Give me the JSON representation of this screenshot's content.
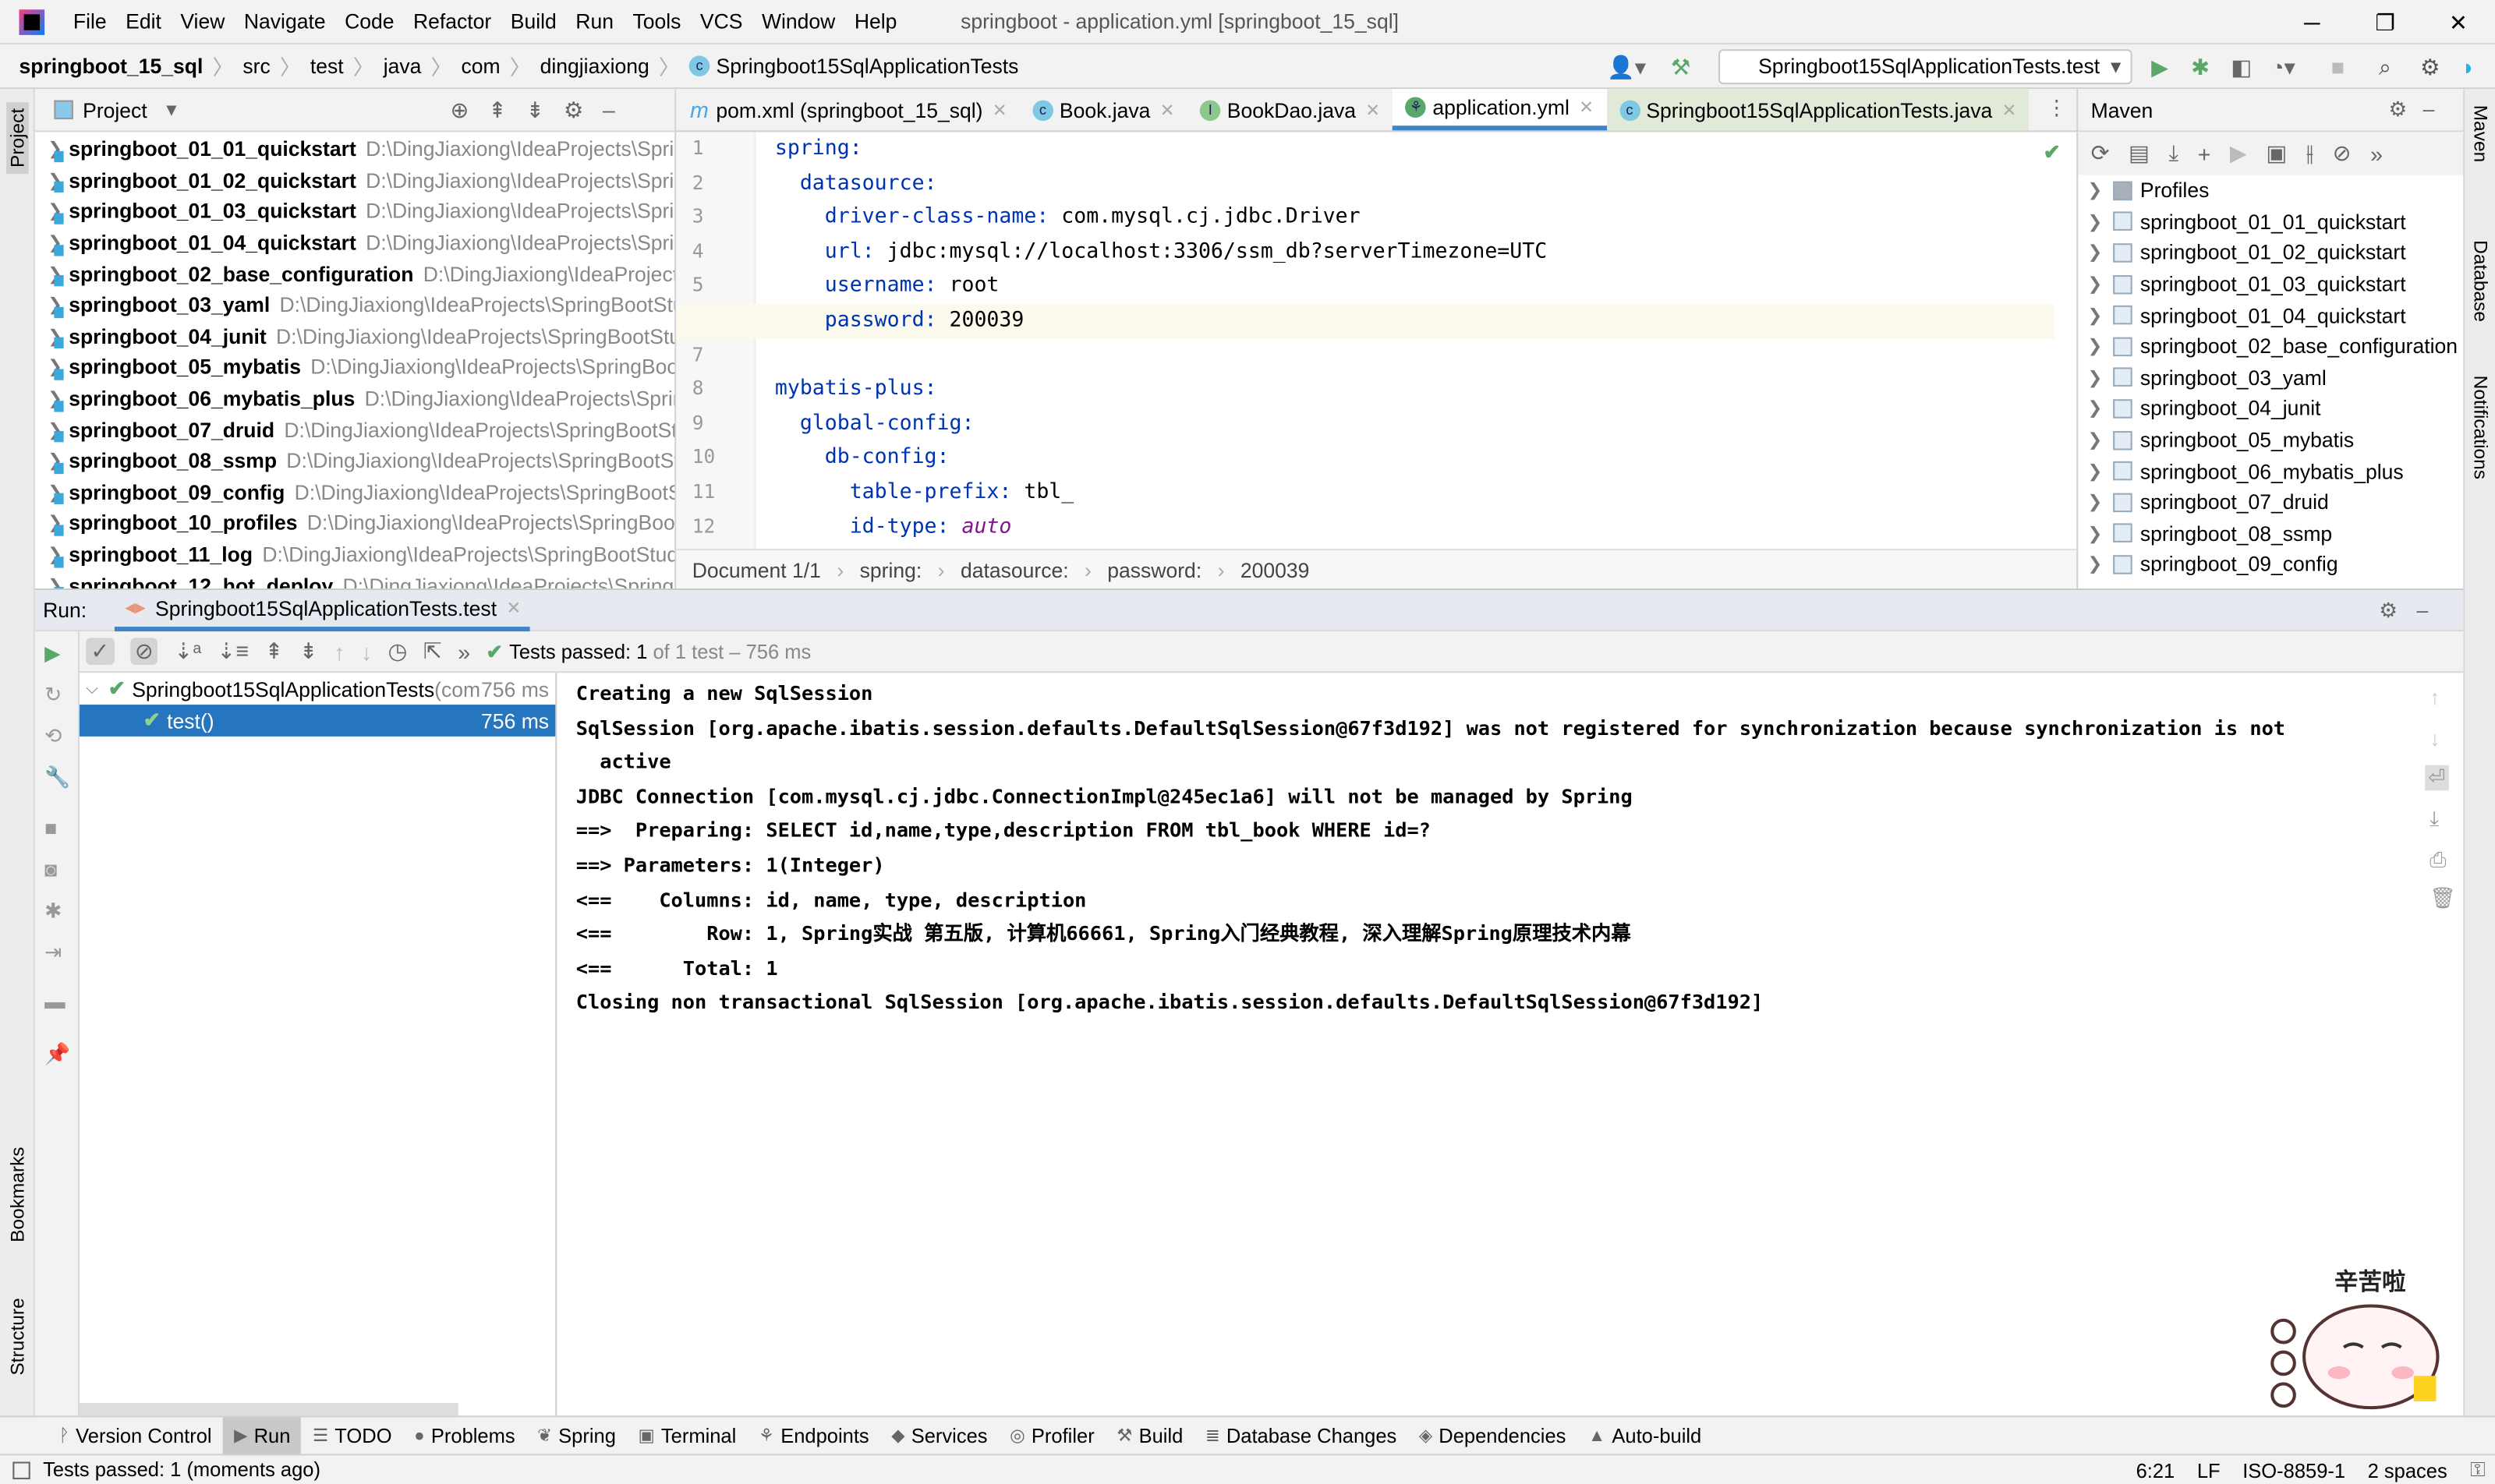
{
  "menu": {
    "items": [
      "File",
      "Edit",
      "View",
      "Navigate",
      "Code",
      "Refactor",
      "Build",
      "Run",
      "Tools",
      "VCS",
      "Window",
      "Help"
    ],
    "window_title": "springboot - application.yml [springboot_15_sql]"
  },
  "navbar": {
    "crumbs": [
      "springboot_15_sql",
      "src",
      "test",
      "java",
      "com",
      "dingjiaxiong",
      "Springboot15SqlApplicationTests"
    ],
    "run_config": "Springboot15SqlApplicationTests.test"
  },
  "left_stripe": {
    "project": "Project",
    "bookmarks": "Bookmarks",
    "structure": "Structure"
  },
  "project": {
    "title": "Project",
    "items": [
      {
        "name": "springboot_01_01_quickstart",
        "path": "D:\\DingJiaxiong\\IdeaProjects\\SpringBootStudy"
      },
      {
        "name": "springboot_01_02_quickstart",
        "path": "D:\\DingJiaxiong\\IdeaProjects\\SpringBootStudy"
      },
      {
        "name": "springboot_01_03_quickstart",
        "path": "D:\\DingJiaxiong\\IdeaProjects\\SpringBootStudy"
      },
      {
        "name": "springboot_01_04_quickstart",
        "path": "D:\\DingJiaxiong\\IdeaProjects\\SpringBootStudy"
      },
      {
        "name": "springboot_02_base_configuration",
        "path": "D:\\DingJiaxiong\\IdeaProjects\\SpringBootStudy"
      },
      {
        "name": "springboot_03_yaml",
        "path": "D:\\DingJiaxiong\\IdeaProjects\\SpringBootStudy"
      },
      {
        "name": "springboot_04_junit",
        "path": "D:\\DingJiaxiong\\IdeaProjects\\SpringBootStudy"
      },
      {
        "name": "springboot_05_mybatis",
        "path": "D:\\DingJiaxiong\\IdeaProjects\\SpringBootStudy"
      },
      {
        "name": "springboot_06_mybatis_plus",
        "path": "D:\\DingJiaxiong\\IdeaProjects\\SpringBootStudy"
      },
      {
        "name": "springboot_07_druid",
        "path": "D:\\DingJiaxiong\\IdeaProjects\\SpringBootStudy"
      },
      {
        "name": "springboot_08_ssmp",
        "path": "D:\\DingJiaxiong\\IdeaProjects\\SpringBootStudy"
      },
      {
        "name": "springboot_09_config",
        "path": "D:\\DingJiaxiong\\IdeaProjects\\SpringBootStudy"
      },
      {
        "name": "springboot_10_profiles",
        "path": "D:\\DingJiaxiong\\IdeaProjects\\SpringBootStudy"
      },
      {
        "name": "springboot_11_log",
        "path": "D:\\DingJiaxiong\\IdeaProjects\\SpringBootStudy"
      },
      {
        "name": "springboot_12_hot_deploy",
        "path": "D:\\DingJiaxiong\\IdeaProjects\\SpringBootStudy"
      }
    ]
  },
  "editor": {
    "tabs": [
      "pom.xml (springboot_15_sql)",
      "Book.java",
      "BookDao.java",
      "application.yml",
      "Springboot15SqlApplicationTests.java"
    ],
    "lines": [
      {
        "n": "1",
        "k": "spring:",
        "v": ""
      },
      {
        "n": "2",
        "k": "  datasource:",
        "v": ""
      },
      {
        "n": "3",
        "k": "    driver-class-name:",
        "v": " com.mysql.cj.jdbc.Driver"
      },
      {
        "n": "4",
        "k": "    url:",
        "v": " jdbc:mysql://localhost:3306/ssm_db?serverTimezone=UTC"
      },
      {
        "n": "5",
        "k": "    username:",
        "v": " root"
      },
      {
        "n": "6",
        "k": "    password:",
        "v": " 200039"
      },
      {
        "n": "7",
        "k": "",
        "v": ""
      },
      {
        "n": "8",
        "k": "mybatis-plus:",
        "v": ""
      },
      {
        "n": "9",
        "k": "  global-config:",
        "v": ""
      },
      {
        "n": "10",
        "k": "    db-config:",
        "v": ""
      },
      {
        "n": "11",
        "k": "      table-prefix:",
        "v": " tbl_"
      },
      {
        "n": "12",
        "k": "      id-type:",
        "v": " auto"
      }
    ],
    "breadcrumb": [
      "Document 1/1",
      "spring:",
      "datasource:",
      "password:",
      "200039"
    ]
  },
  "maven": {
    "title": "Maven",
    "items": [
      "Profiles",
      "springboot_01_01_quickstart",
      "springboot_01_02_quickstart",
      "springboot_01_03_quickstart",
      "springboot_01_04_quickstart",
      "springboot_02_base_configuration",
      "springboot_03_yaml",
      "springboot_04_junit",
      "springboot_05_mybatis",
      "springboot_06_mybatis_plus",
      "springboot_07_druid",
      "springboot_08_ssmp",
      "springboot_09_config"
    ]
  },
  "right_stripe": {
    "maven": "Maven",
    "database": "Database",
    "notifications": "Notifications"
  },
  "run": {
    "label": "Run:",
    "tab": "Springboot15SqlApplicationTests.test",
    "status_passed": "Tests passed: 1",
    "status_rest": " of 1 test – 756 ms",
    "tree": [
      {
        "name": "Springboot15SqlApplicationTests",
        "extra": " (com",
        "time": "756 ms"
      },
      {
        "name": "test()",
        "time": "756 ms"
      }
    ],
    "console": [
      "Creating a new SqlSession",
      "SqlSession [org.apache.ibatis.session.defaults.DefaultSqlSession@67f3d192] was not registered for synchronization because synchronization is not",
      "  active",
      "JDBC Connection [com.mysql.cj.jdbc.ConnectionImpl@245ec1a6] will not be managed by Spring",
      "==>  Preparing: SELECT id,name,type,description FROM tbl_book WHERE id=?",
      "==> Parameters: 1(Integer)",
      "<==    Columns: id, name, type, description",
      "<==        Row: 1, Spring实战 第五版, 计算机66661, Spring入门经典教程, 深入理解Spring原理技术内幕",
      "<==      Total: 1",
      "Closing non transactional SqlSession [org.apache.ibatis.session.defaults.DefaultSqlSession@67f3d192]"
    ]
  },
  "tool_windows": [
    "Version Control",
    "Run",
    "TODO",
    "Problems",
    "Spring",
    "Terminal",
    "Endpoints",
    "Services",
    "Profiler",
    "Build",
    "Database Changes",
    "Dependencies",
    "Auto-build"
  ],
  "status": {
    "message": "Tests passed: 1 (moments ago)",
    "position": "6:21",
    "line_sep": "LF",
    "encoding": "ISO-8859-1",
    "indent": "2 spaces"
  },
  "sticker": {
    "text": "辛苦啦"
  },
  "colors": {
    "accent": "#4083c9",
    "selection": "#2675bf",
    "pass": "#59a869",
    "keyword": "#0033b3"
  }
}
